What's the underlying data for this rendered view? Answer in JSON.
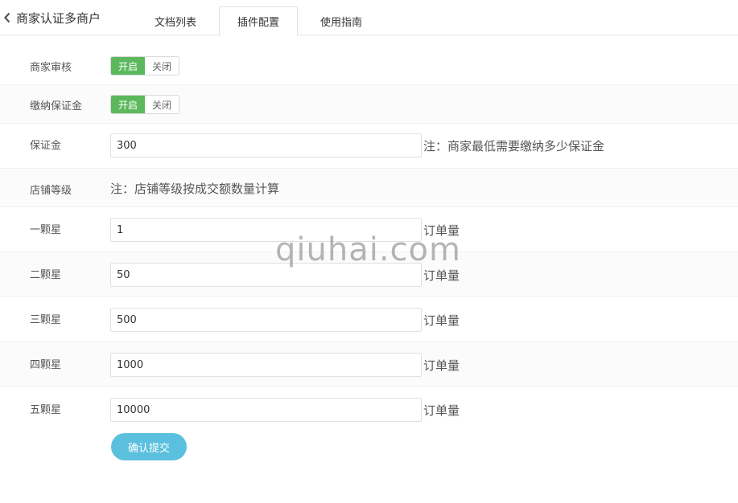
{
  "header": {
    "title": "商家认证多商户",
    "tabs": [
      "文档列表",
      "插件配置",
      "使用指南"
    ],
    "active_tab": "插件配置"
  },
  "form": {
    "merchant_review": {
      "label": "商家审核",
      "on": "开启",
      "off": "关闭",
      "selected": "开启"
    },
    "deposit_enabled": {
      "label": "缴纳保证金",
      "on": "开启",
      "off": "关闭",
      "selected": "开启"
    },
    "deposit": {
      "label": "保证金",
      "value": "300",
      "note": "注：商家最低需要缴纳多少保证金"
    },
    "store_level": {
      "label": "店铺等级",
      "note": "注：店铺等级按成交额数量计算"
    },
    "stars": [
      {
        "label": "一颗星",
        "value": "1",
        "unit": "订单量"
      },
      {
        "label": "二颗星",
        "value": "50",
        "unit": "订单量"
      },
      {
        "label": "三颗星",
        "value": "500",
        "unit": "订单量"
      },
      {
        "label": "四颗星",
        "value": "1000",
        "unit": "订单量"
      },
      {
        "label": "五颗星",
        "value": "10000",
        "unit": "订单量"
      }
    ],
    "submit_label": "确认提交"
  },
  "watermark": "qiuhai.com",
  "colors": {
    "switch_on": "#5cb85c",
    "submit": "#5bc0de"
  }
}
